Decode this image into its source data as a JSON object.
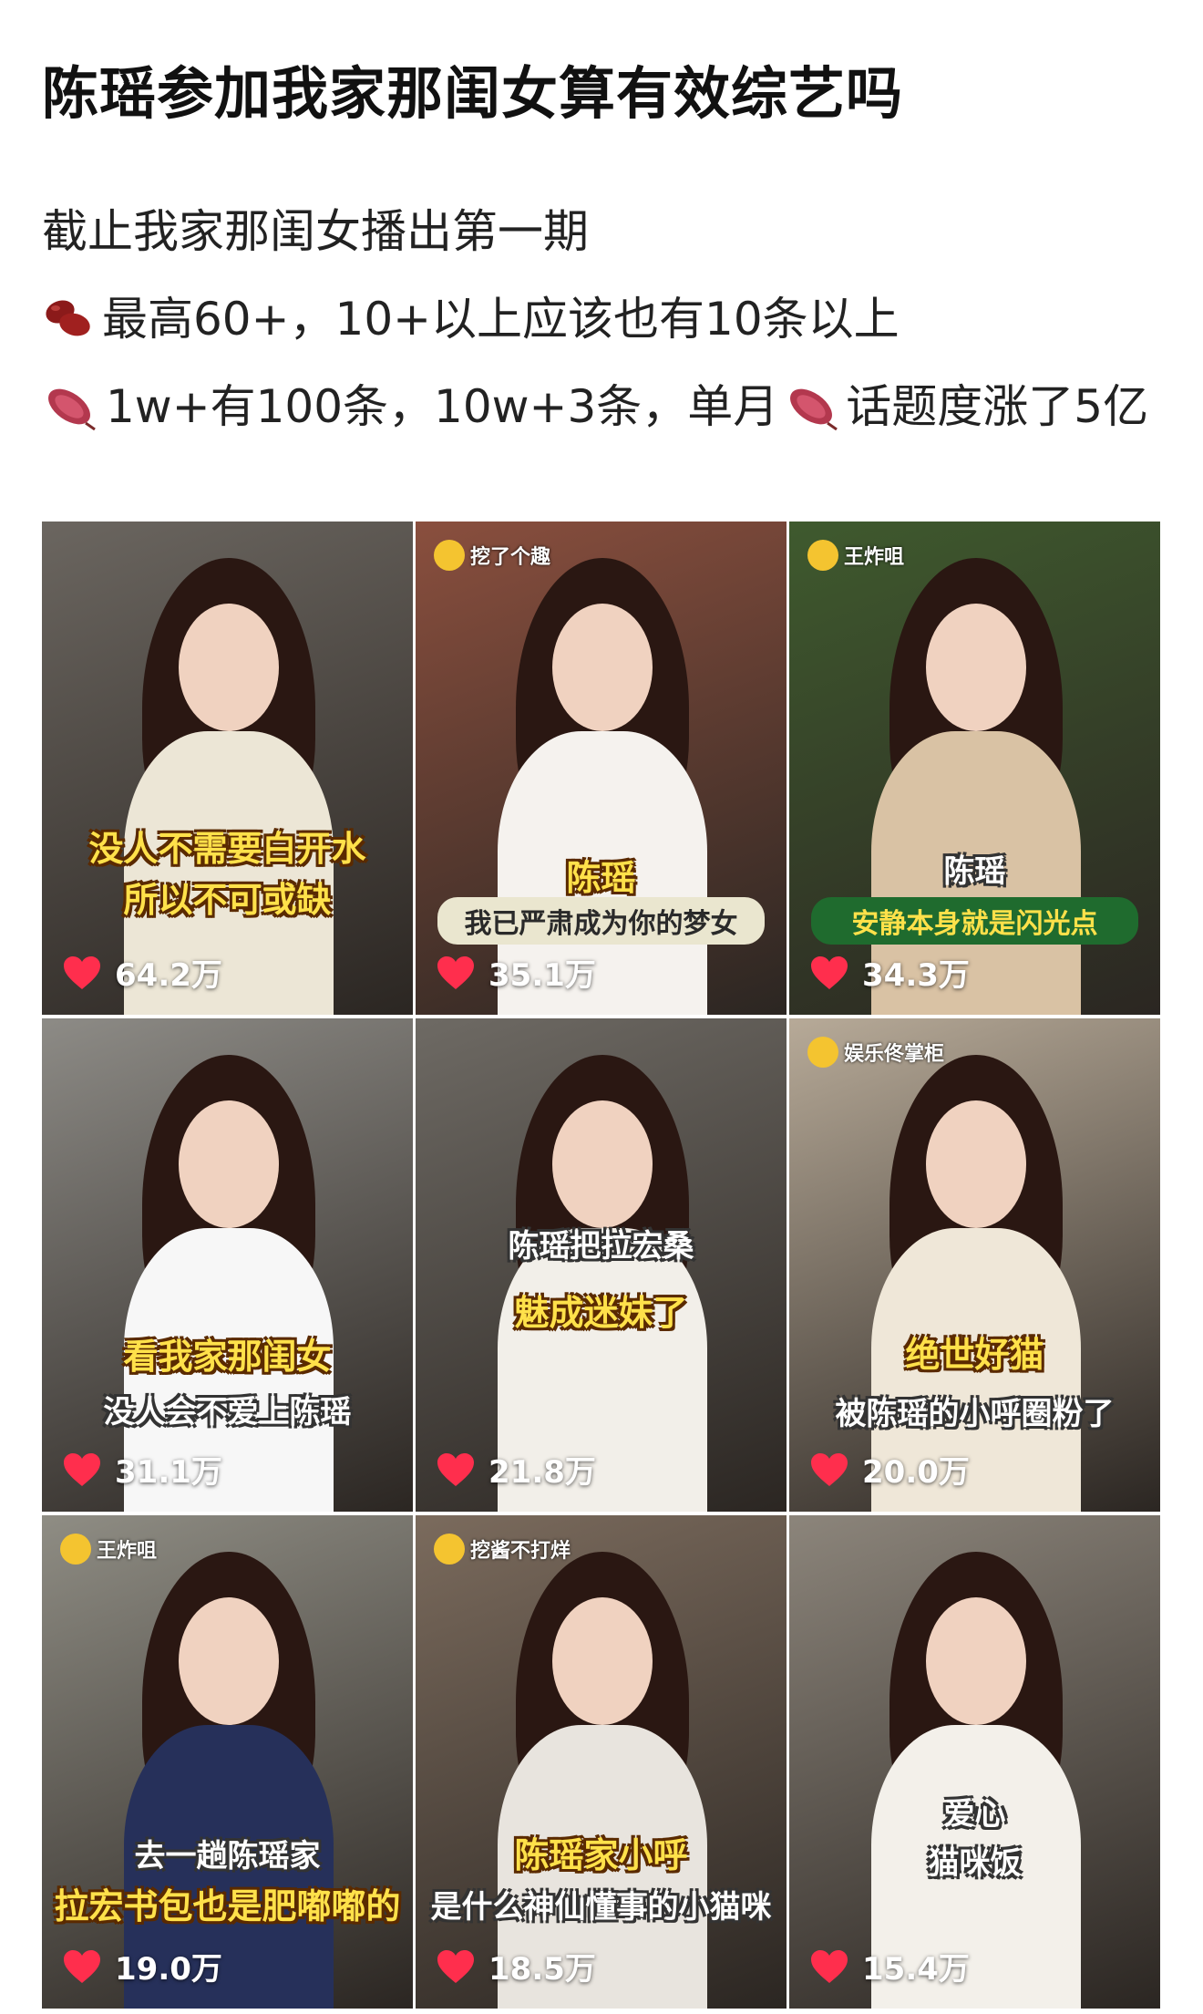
{
  "post": {
    "title": "陈瑶参加我家那闺女算有效综艺吗",
    "lines": [
      "截止我家那闺女播出第一期",
      "最高60+，10+以上应该也有10条以上",
      "1w+有100条，10w+3条，单月",
      "话题度涨了5亿"
    ]
  },
  "emoji": {
    "bean": "bean-icon",
    "sweet_potato": "sweet-potato-icon"
  },
  "colors": {
    "heart": "#ff2e4d",
    "caption_yellow": "#ffe14a"
  },
  "grid": [
    {
      "tag": "",
      "captions": [
        "没人不需要白开水",
        "所以不可或缺"
      ],
      "likes": "64.2万",
      "bg": "#6b6660",
      "accent": "#ece6d6"
    },
    {
      "tag": "挖了个趣",
      "captions": [
        "陈瑶",
        "我已严肃成为你的梦女"
      ],
      "likes": "35.1万",
      "bg": "#8a4f3e",
      "accent": "#f5f2ee"
    },
    {
      "tag": "王炸咀",
      "captions": [
        "陈瑶",
        "安静本身就是闪光点"
      ],
      "likes": "34.3万",
      "bg": "#3f5a2e",
      "accent": "#d9c2a4"
    },
    {
      "tag": "",
      "captions": [
        "看我家那闺女",
        "没人会不爱上陈瑶"
      ],
      "likes": "31.1万",
      "bg": "#8d8b86",
      "accent": "#f7f7f7"
    },
    {
      "tag": "",
      "captions": [
        "陈瑶把拉宏桑",
        "魅成迷妹了"
      ],
      "likes": "21.8万",
      "bg": "#6e6a64",
      "accent": "#f2efe9"
    },
    {
      "tag": "娱乐佟掌柜",
      "captions": [
        "绝世好猫",
        "被陈瑶的小呼圈粉了"
      ],
      "likes": "20.0万",
      "bg": "#b7aa98",
      "accent": "#efe7d8"
    },
    {
      "tag": "王炸咀",
      "captions": [
        "去一趟陈瑶家",
        "拉宏书包也是肥嘟嘟的"
      ],
      "likes": "19.0万",
      "bg": "#8f8d84",
      "accent": "#26305a"
    },
    {
      "tag": "挖酱不打烊",
      "captions": [
        "陈瑶家小呼",
        "是什么神仙懂事的小猫咪"
      ],
      "likes": "18.5万",
      "bg": "#7b6b5d",
      "accent": "#e8e4de"
    },
    {
      "tag": "",
      "captions": [
        "爱心",
        "猫咪饭"
      ],
      "likes": "15.4万",
      "bg": "#8c857b",
      "accent": "#f3f0ea"
    }
  ]
}
